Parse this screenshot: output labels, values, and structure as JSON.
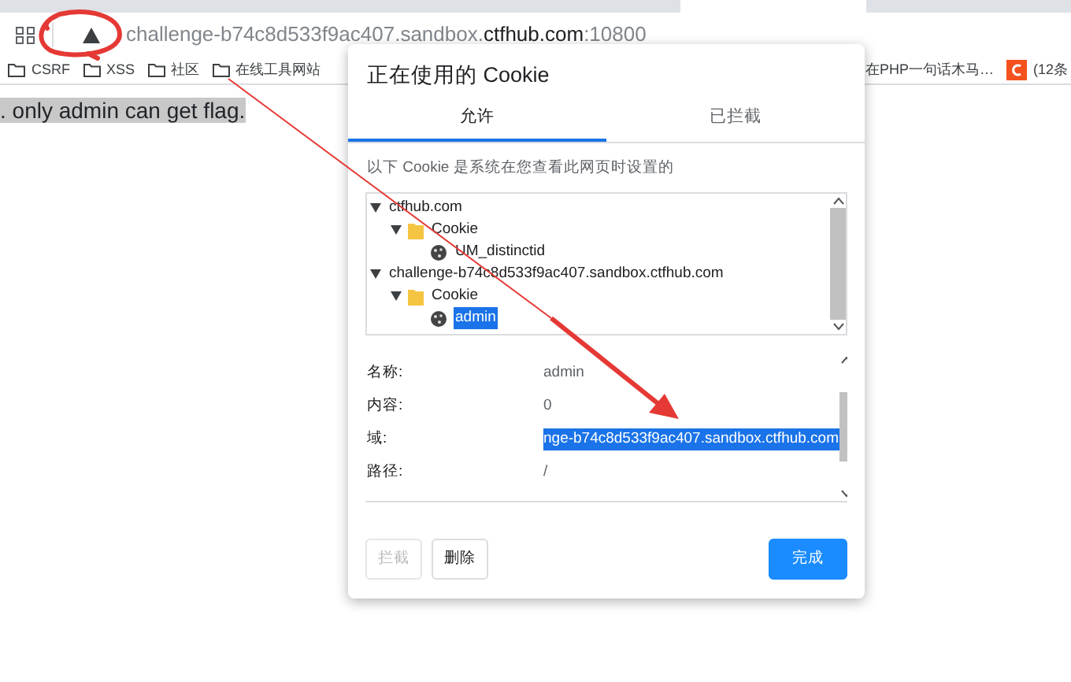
{
  "address_bar": {
    "url": {
      "host": "challenge-b74c8d533f9ac407.sandbox.",
      "domain": "ctfhub.com",
      "port": ":10800"
    },
    "insecure": true
  },
  "bookmarks": [
    {
      "label": "CSRF",
      "kind": "folder"
    },
    {
      "label": "XSS",
      "kind": "folder"
    },
    {
      "label": "社区",
      "kind": "folder"
    },
    {
      "label": "在线工具网站",
      "kind": "folder"
    },
    {
      "label": "在PHP一句话木马…",
      "kind": "page"
    },
    {
      "label": "(12条",
      "kind": "csdn"
    }
  ],
  "page": {
    "text": ". only admin can get flag.",
    "selected": true
  },
  "dialog": {
    "title": "正在使用的 Cookie",
    "tabs": [
      {
        "label": "允许",
        "selected": true
      },
      {
        "label": "已拦截",
        "selected": false
      }
    ],
    "description": "以下 Cookie 是系统在您查看此网页时设置的",
    "tree": [
      {
        "label": "ctfhub.com",
        "kind": "site",
        "expanded": true,
        "selected": false,
        "children": [
          {
            "label": "Cookie",
            "kind": "folder",
            "expanded": true,
            "selected": false,
            "children": [
              {
                "label": "UM_distinctid",
                "kind": "cookie",
                "selected": false
              }
            ]
          }
        ]
      },
      {
        "label": "challenge-b74c8d533f9ac407.sandbox.ctfhub.com",
        "kind": "site",
        "expanded": true,
        "selected": false,
        "children": [
          {
            "label": "Cookie",
            "kind": "folder",
            "expanded": true,
            "selected": false,
            "children": [
              {
                "label": "admin",
                "kind": "cookie",
                "selected": true
              }
            ]
          }
        ]
      }
    ],
    "details": [
      {
        "label": "名称:",
        "value": "admin",
        "selected": false
      },
      {
        "label": "内容:",
        "value": "0",
        "selected": false
      },
      {
        "label": "域:",
        "value": "nge-b74c8d533f9ac407.sandbox.ctfhub.com",
        "selected": true
      },
      {
        "label": "路径:",
        "value": "/",
        "selected": false
      }
    ],
    "buttons": [
      {
        "label": "拦截",
        "kind": "secondary",
        "disabled": true
      },
      {
        "label": "删除",
        "kind": "secondary",
        "disabled": false
      },
      {
        "label": "完成",
        "kind": "primary",
        "disabled": false
      }
    ]
  }
}
